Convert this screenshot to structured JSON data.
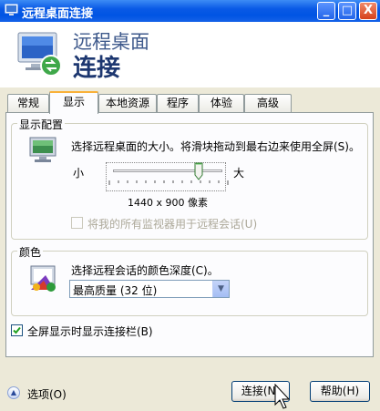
{
  "window": {
    "title": "远程桌面连接",
    "controls": [
      "_",
      "□",
      "X"
    ]
  },
  "banner": {
    "line1": "远程桌面",
    "line2": "连接"
  },
  "tabs": [
    {
      "label": "常规",
      "active": false
    },
    {
      "label": "显示",
      "active": true
    },
    {
      "label": "本地资源",
      "active": false
    },
    {
      "label": "程序",
      "active": false
    },
    {
      "label": "体验",
      "active": false
    },
    {
      "label": "高级",
      "active": false
    }
  ],
  "display_config": {
    "legend": "显示配置",
    "desc": "选择远程桌面的大小。将滑块拖动到最右边来使用全屏(S)。",
    "small": "小",
    "large": "大",
    "resolution": "1440 x 900 像素",
    "multi_monitor": "将我的所有监视器用于远程会话(U)",
    "slider_fraction": 0.78
  },
  "colors": {
    "legend": "颜色",
    "desc": "选择远程会话的颜色深度(C)。",
    "selected": "最高质量 (32 位)"
  },
  "fullscreen_bar": {
    "label": "全屏显示时显示连接栏(B)",
    "checked": true
  },
  "footer": {
    "options": "选项(O)",
    "connect": "连接(N)",
    "help": "帮助(H)"
  }
}
